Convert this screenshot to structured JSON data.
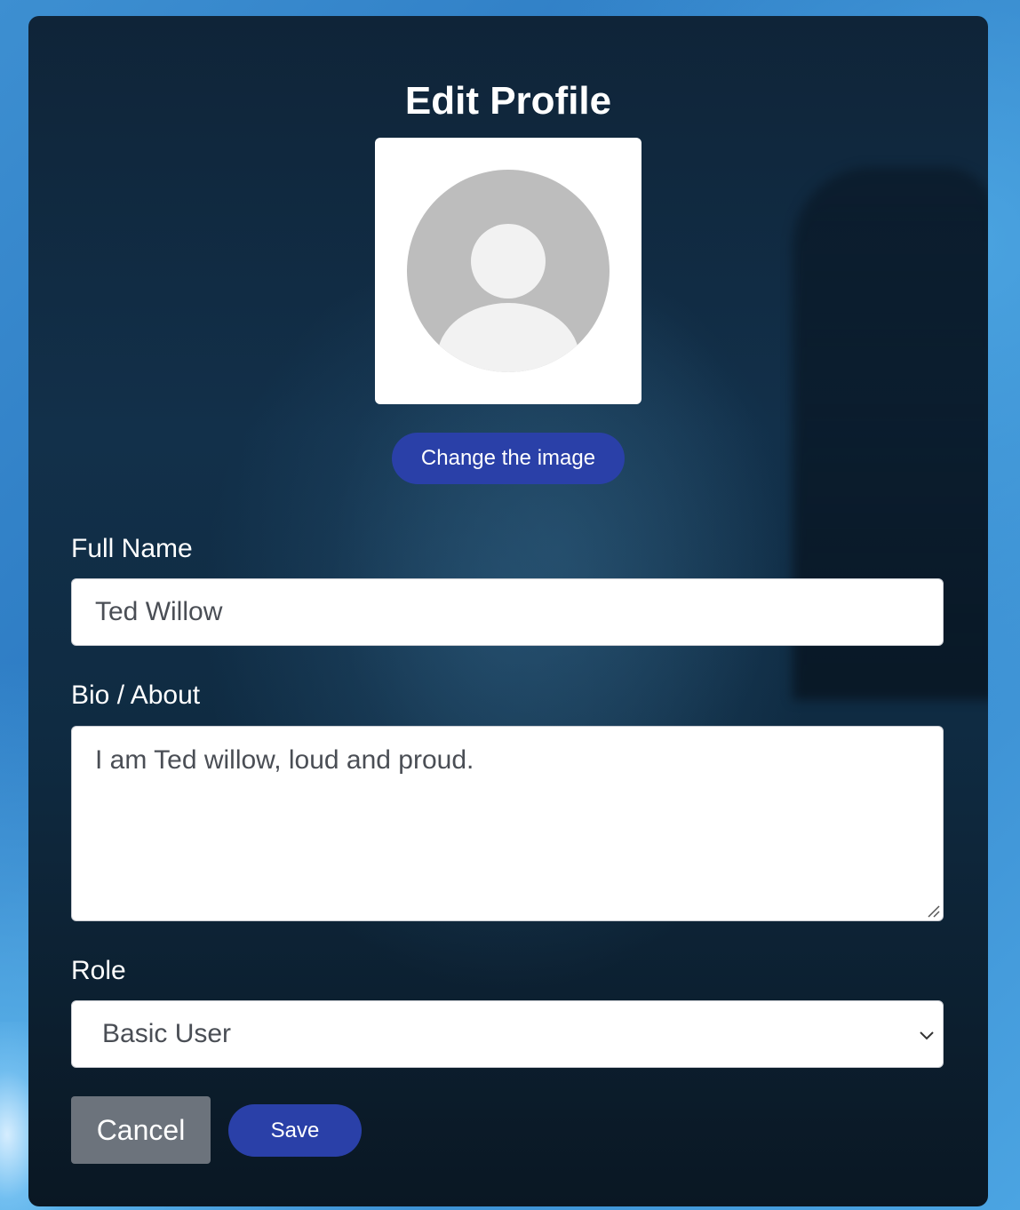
{
  "page": {
    "title": "Edit Profile"
  },
  "avatar": {
    "icon": "default-user-avatar-icon",
    "change_button_label": "Change the image"
  },
  "form": {
    "full_name": {
      "label": "Full Name",
      "value": "Ted Willow"
    },
    "bio": {
      "label": "Bio / About",
      "value": "I am Ted willow, loud and proud."
    },
    "role": {
      "label": "Role",
      "selected": "Basic User"
    }
  },
  "actions": {
    "cancel_label": "Cancel",
    "save_label": "Save"
  },
  "colors": {
    "primary_button": "#2a40a8",
    "cancel_button": "#6c737c",
    "card_background": "#0f2438"
  }
}
